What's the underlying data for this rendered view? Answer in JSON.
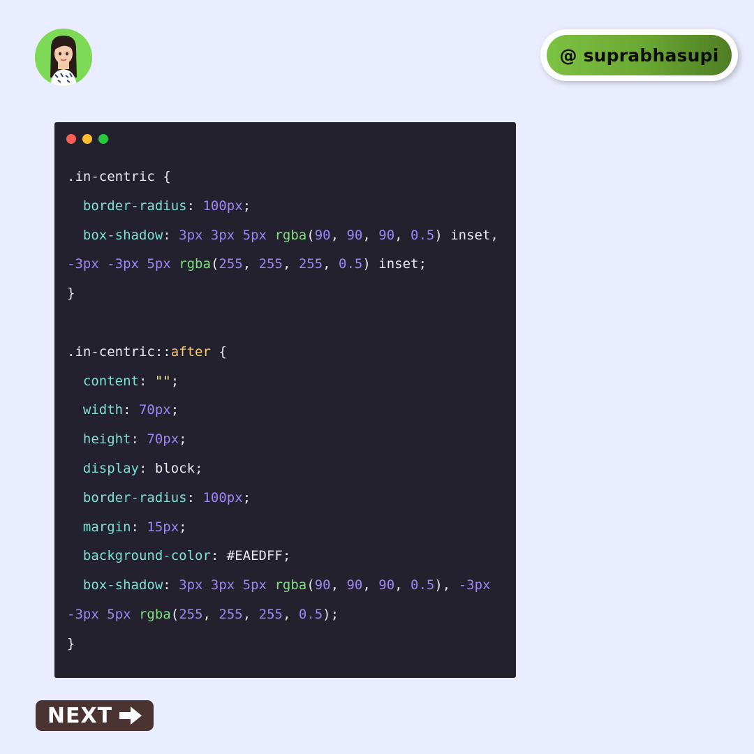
{
  "header": {
    "avatar_name": "avatar-icon",
    "handle": "@ suprabhasupi"
  },
  "window_controls": {
    "colors": [
      "#ff5f56",
      "#ffbd2e",
      "#27c93f"
    ]
  },
  "code_lines": [
    [
      {
        "t": ".in-centric {",
        "c": "txt"
      }
    ],
    [
      {
        "t": "  border-radius",
        "c": "prop"
      },
      {
        "t": ": ",
        "c": "txt"
      },
      {
        "t": "100px",
        "c": "num"
      },
      {
        "t": ";",
        "c": "txt"
      }
    ],
    [
      {
        "t": "  box-shadow",
        "c": "prop"
      },
      {
        "t": ": ",
        "c": "txt"
      },
      {
        "t": "3px 3px 5px",
        "c": "num"
      },
      {
        "t": " ",
        "c": "txt"
      },
      {
        "t": "rgba",
        "c": "fn"
      },
      {
        "t": "(",
        "c": "txt"
      },
      {
        "t": "90",
        "c": "num"
      },
      {
        "t": ", ",
        "c": "txt"
      },
      {
        "t": "90",
        "c": "num"
      },
      {
        "t": ", ",
        "c": "txt"
      },
      {
        "t": "90",
        "c": "num"
      },
      {
        "t": ", ",
        "c": "txt"
      },
      {
        "t": "0.5",
        "c": "num"
      },
      {
        "t": ") inset,",
        "c": "txt"
      }
    ],
    [
      {
        "t": "-3px -3px 5px",
        "c": "num"
      },
      {
        "t": " ",
        "c": "txt"
      },
      {
        "t": "rgba",
        "c": "fn"
      },
      {
        "t": "(",
        "c": "txt"
      },
      {
        "t": "255",
        "c": "num"
      },
      {
        "t": ", ",
        "c": "txt"
      },
      {
        "t": "255",
        "c": "num"
      },
      {
        "t": ", ",
        "c": "txt"
      },
      {
        "t": "255",
        "c": "num"
      },
      {
        "t": ", ",
        "c": "txt"
      },
      {
        "t": "0.5",
        "c": "num"
      },
      {
        "t": ") inset;",
        "c": "txt"
      }
    ],
    [
      {
        "t": "}",
        "c": "txt"
      }
    ],
    [],
    [
      {
        "t": ".in-centric::",
        "c": "txt"
      },
      {
        "t": "after",
        "c": "pseudo"
      },
      {
        "t": " {",
        "c": "txt"
      }
    ],
    [
      {
        "t": "  content",
        "c": "prop"
      },
      {
        "t": ": ",
        "c": "txt"
      },
      {
        "t": "\"\"",
        "c": "str"
      },
      {
        "t": ";",
        "c": "txt"
      }
    ],
    [
      {
        "t": "  width",
        "c": "prop"
      },
      {
        "t": ": ",
        "c": "txt"
      },
      {
        "t": "70px",
        "c": "num"
      },
      {
        "t": ";",
        "c": "txt"
      }
    ],
    [
      {
        "t": "  height",
        "c": "prop"
      },
      {
        "t": ": ",
        "c": "txt"
      },
      {
        "t": "70px",
        "c": "num"
      },
      {
        "t": ";",
        "c": "txt"
      }
    ],
    [
      {
        "t": "  display",
        "c": "prop"
      },
      {
        "t": ": block;",
        "c": "txt"
      }
    ],
    [
      {
        "t": "  border-radius",
        "c": "prop"
      },
      {
        "t": ": ",
        "c": "txt"
      },
      {
        "t": "100px",
        "c": "num"
      },
      {
        "t": ";",
        "c": "txt"
      }
    ],
    [
      {
        "t": "  margin",
        "c": "prop"
      },
      {
        "t": ": ",
        "c": "txt"
      },
      {
        "t": "15px",
        "c": "num"
      },
      {
        "t": ";",
        "c": "txt"
      }
    ],
    [
      {
        "t": "  background-color",
        "c": "prop"
      },
      {
        "t": ": #EAEDFF;",
        "c": "txt"
      }
    ],
    [
      {
        "t": "  box-shadow",
        "c": "prop"
      },
      {
        "t": ": ",
        "c": "txt"
      },
      {
        "t": "3px 3px 5px",
        "c": "num"
      },
      {
        "t": " ",
        "c": "txt"
      },
      {
        "t": "rgba",
        "c": "fn"
      },
      {
        "t": "(",
        "c": "txt"
      },
      {
        "t": "90",
        "c": "num"
      },
      {
        "t": ", ",
        "c": "txt"
      },
      {
        "t": "90",
        "c": "num"
      },
      {
        "t": ", ",
        "c": "txt"
      },
      {
        "t": "90",
        "c": "num"
      },
      {
        "t": ", ",
        "c": "txt"
      },
      {
        "t": "0.5",
        "c": "num"
      },
      {
        "t": "), ",
        "c": "txt"
      },
      {
        "t": "-3px",
        "c": "num"
      }
    ],
    [
      {
        "t": "-3px 5px",
        "c": "num"
      },
      {
        "t": " ",
        "c": "txt"
      },
      {
        "t": "rgba",
        "c": "fn"
      },
      {
        "t": "(",
        "c": "txt"
      },
      {
        "t": "255",
        "c": "num"
      },
      {
        "t": ", ",
        "c": "txt"
      },
      {
        "t": "255",
        "c": "num"
      },
      {
        "t": ", ",
        "c": "txt"
      },
      {
        "t": "255",
        "c": "num"
      },
      {
        "t": ", ",
        "c": "txt"
      },
      {
        "t": "0.5",
        "c": "num"
      },
      {
        "t": ");",
        "c": "txt"
      }
    ],
    [
      {
        "t": "}",
        "c": "txt"
      }
    ]
  ],
  "footer": {
    "next_label": "NEXT",
    "next_icon": "arrow-right-icon"
  },
  "colors": {
    "page_background": "#EAEDFF",
    "code_background": "#23212e",
    "handle_gradient_start": "#7dc242",
    "handle_gradient_end": "#4f7d24",
    "next_button_bg": "#4a3330"
  }
}
